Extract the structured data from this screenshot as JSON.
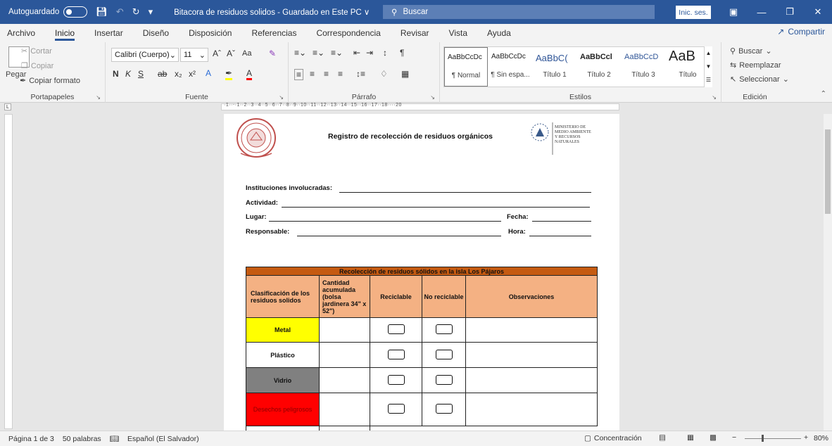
{
  "titlebar": {
    "autosave_label": "Autoguardado",
    "document_title": "Bitacora de residuos solidos  -  Guardado en Este PC  ∨",
    "search_label": "Buscar",
    "signin_label": "Inic. ses."
  },
  "menu": {
    "tabs": [
      "Archivo",
      "Inicio",
      "Insertar",
      "Diseño",
      "Disposición",
      "Referencias",
      "Correspondencia",
      "Revisar",
      "Vista",
      "Ayuda"
    ],
    "active_tab": "Inicio",
    "share_label": "Compartir"
  },
  "ribbon": {
    "clipboard": {
      "paste": "Pegar",
      "cut": "Cortar",
      "copy": "Copiar",
      "format_painter": "Copiar formato",
      "label": "Portapapeles"
    },
    "font": {
      "font_name": "Calibri (Cuerpo)",
      "font_size": "11",
      "label": "Fuente",
      "change_case": "Aa"
    },
    "paragraph": {
      "label": "Párrafo"
    },
    "styles": {
      "label": "Estilos",
      "items": [
        {
          "sample": "AaBbCcDc",
          "name": "¶ Normal"
        },
        {
          "sample": "AaBbCcDc",
          "name": "¶ Sin espa..."
        },
        {
          "sample": "AaBbC(",
          "name": "Título 1"
        },
        {
          "sample": "AaBbCcl",
          "name": "Título 2"
        },
        {
          "sample": "AaBbCcD",
          "name": "Título 3"
        },
        {
          "sample": "AaB",
          "name": "Título"
        }
      ]
    },
    "editing": {
      "label": "Edición",
      "find": "Buscar",
      "replace": "Reemplazar",
      "select": "Seleccionar"
    }
  },
  "document": {
    "heading": "Registro de recolección de residuos orgánicos",
    "ministry_lines": [
      "MINISTERIO DE",
      "MEDIO AMBIENTE",
      "Y RECURSOS",
      "NATURALES"
    ],
    "fields": {
      "instituciones": "Instituciones involucradas:",
      "actividad": "Actividad:",
      "lugar": "Lugar:",
      "fecha": "Fecha:",
      "responsable": "Responsable:",
      "hora": "Hora:"
    },
    "table": {
      "caption": "Recolección de residuos sólidos en la isla Los Pájaros",
      "headers": {
        "classification": "Clasificación de los residuos solidos",
        "quantity": "Cantidad acumulada (bolsa jardinera 34\" x 52\")",
        "recyclable": "Reciclable",
        "non_recyclable": "No reciclable",
        "observations": "Observaciones"
      },
      "rows": [
        {
          "name": "Metal",
          "color": "#ffff00",
          "text_color": "#111111"
        },
        {
          "name": "Plástico",
          "color": "#ffffff",
          "text_color": "#111111"
        },
        {
          "name": "Vidrio",
          "color": "#808080",
          "text_color": "#111111"
        },
        {
          "name": "Desechos peligrosos",
          "color": "#ff0000",
          "text_color": "#8b0000"
        }
      ]
    }
  },
  "statusbar": {
    "page": "Página 1 de 3",
    "words": "50 palabras",
    "language": "Español (El Salvador)",
    "focus": "Concentración",
    "zoom": "80%"
  },
  "colors": {
    "word_blue": "#2b579a",
    "table_header": "#f4b183",
    "table_caption": "#c55a11"
  }
}
